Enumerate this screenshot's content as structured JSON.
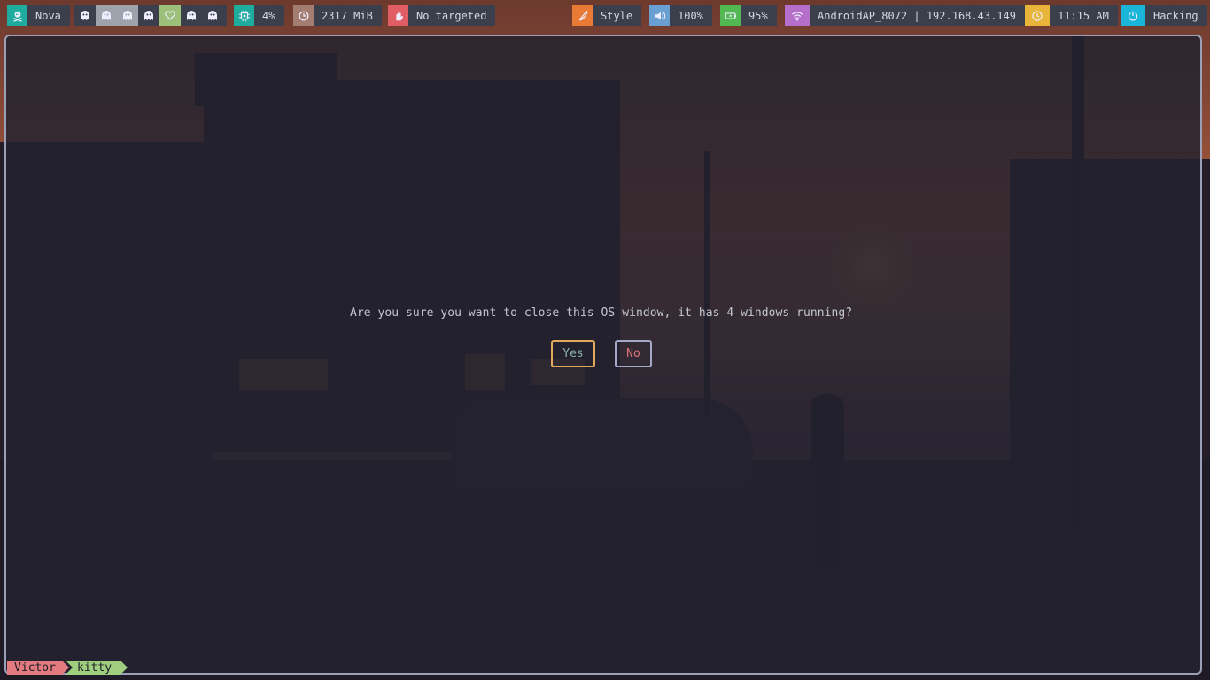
{
  "topbar": {
    "session": {
      "label": "Nova",
      "icon": "skull-crossbones-icon",
      "color": "#1dac9e"
    },
    "workspaces": [
      {
        "icon": "ghost-icon",
        "state": "empty"
      },
      {
        "icon": "ghost-icon",
        "state": "occupied"
      },
      {
        "icon": "ghost-icon",
        "state": "occupied"
      },
      {
        "icon": "ghost-icon",
        "state": "empty"
      },
      {
        "icon": "heart-icon",
        "state": "active"
      },
      {
        "icon": "ghost-icon",
        "state": "empty"
      },
      {
        "icon": "ghost-icon",
        "state": "empty"
      }
    ],
    "cpu": {
      "label": "4%",
      "icon": "cpu-chip-icon",
      "color": "#1dac9e"
    },
    "memory": {
      "label": "2317 MiB",
      "icon": "pie-clock-icon",
      "color": "#a47d71"
    },
    "window_title": {
      "label": "No targeted",
      "icon": "hand-icon",
      "color": "#e05d63"
    },
    "style": {
      "label": "Style",
      "icon": "brush-icon",
      "color": "#e87a36"
    },
    "volume": {
      "label": "100%",
      "icon": "speaker-icon",
      "color": "#6a9fd1"
    },
    "battery": {
      "label": "95%",
      "icon": "battery-charge-icon",
      "color": "#52b852"
    },
    "network": {
      "label": "AndroidAP_8072 | 192.168.43.149",
      "icon": "wifi-icon",
      "color": "#b56ec9"
    },
    "clock": {
      "label": "11:15 AM",
      "icon": "clock-icon",
      "color": "#e8b43a"
    },
    "power": {
      "label": "Hacking",
      "icon": "power-icon",
      "color": "#1ab6d9"
    }
  },
  "dialog": {
    "message": "Are you sure you want to close this OS window, it has 4 windows running?",
    "yes_label": "Yes",
    "no_label": "No"
  },
  "statusline": {
    "user": "Victor",
    "app": "kitty"
  }
}
